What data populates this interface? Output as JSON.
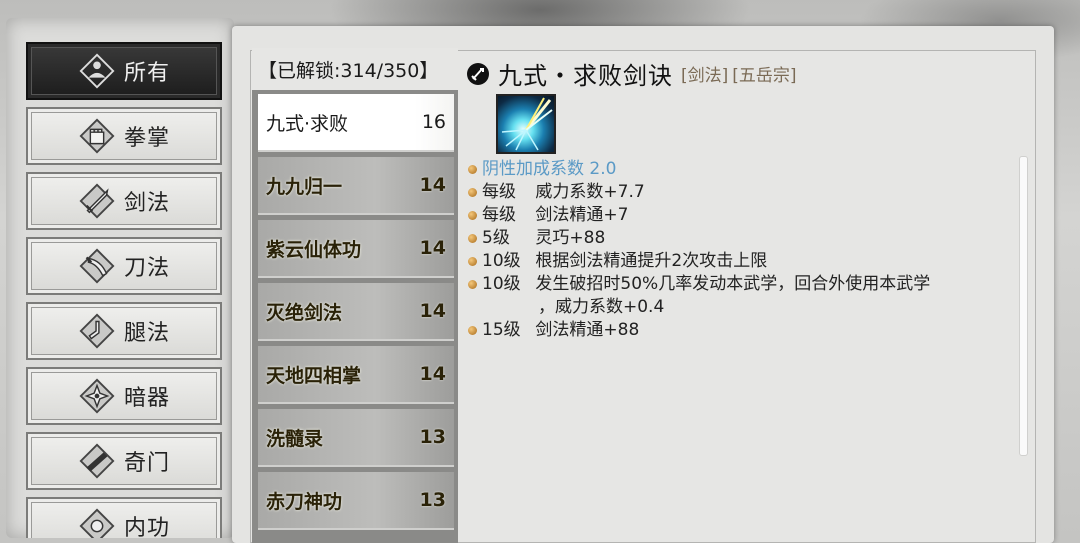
{
  "categories": [
    {
      "label": "所有",
      "icon": "all-icon",
      "active": true
    },
    {
      "label": "拳掌",
      "icon": "fist-icon"
    },
    {
      "label": "剑法",
      "icon": "sword-icon"
    },
    {
      "label": "刀法",
      "icon": "blade-icon"
    },
    {
      "label": "腿法",
      "icon": "kick-icon"
    },
    {
      "label": "暗器",
      "icon": "shuriken-icon"
    },
    {
      "label": "奇门",
      "icon": "exotic-icon"
    },
    {
      "label": "内功",
      "icon": "inner-icon"
    }
  ],
  "list": {
    "header": "【已解锁:314/350】",
    "skills": [
      {
        "name": "九式·求败",
        "level": "16",
        "active": true
      },
      {
        "name": "九九归一",
        "level": "14"
      },
      {
        "name": "紫云仙体功",
        "level": "14"
      },
      {
        "name": "灭绝剑法",
        "level": "14"
      },
      {
        "name": "天地四相掌",
        "level": "14"
      },
      {
        "name": "洗髓录",
        "level": "13"
      },
      {
        "name": "赤刀神功",
        "level": "13"
      }
    ]
  },
  "detail": {
    "title": "九式・求败剑诀",
    "tag_type": "[剑法]",
    "tag_sect": "[五岳宗]",
    "type_icon": "sword-type-icon",
    "effects": [
      {
        "level": "",
        "text": "阴性加成系数 2.0",
        "highlight": true
      },
      {
        "level": "每级",
        "text": "威力系数+7.7"
      },
      {
        "level": "每级",
        "text": "剑法精通+7"
      },
      {
        "level": "5级",
        "text": "灵巧+88"
      },
      {
        "level": "10级",
        "text": "根据剑法精通提升2次攻击上限"
      },
      {
        "level": "10级",
        "text": "发生破招时50%几率发动本武学，回合外使用本武学",
        "cont": "，威力系数+0.4"
      },
      {
        "level": "15级",
        "text": "剑法精通+88"
      }
    ]
  },
  "colors": {
    "highlight_effect": "#5b9ac6",
    "bullet": "#c58a35"
  }
}
